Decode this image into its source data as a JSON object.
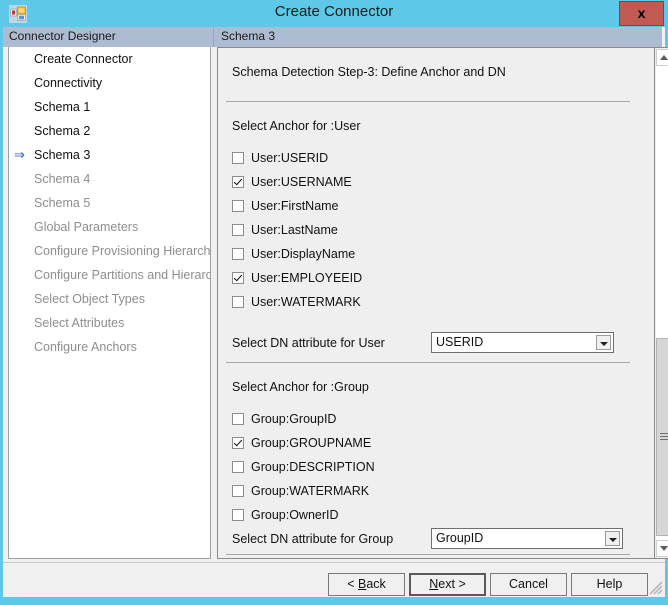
{
  "window": {
    "title": "Create Connector",
    "icon": "connector-app-icon",
    "close_label": "x"
  },
  "sidebar": {
    "header": "Connector Designer",
    "items": [
      {
        "label": "Create Connector",
        "state": "done",
        "current": false
      },
      {
        "label": "Connectivity",
        "state": "done",
        "current": false
      },
      {
        "label": "Schema 1",
        "state": "done",
        "current": false
      },
      {
        "label": "Schema 2",
        "state": "done",
        "current": false
      },
      {
        "label": "Schema 3",
        "state": "done",
        "current": true
      },
      {
        "label": "Schema 4",
        "state": "disabled",
        "current": false
      },
      {
        "label": "Schema 5",
        "state": "disabled",
        "current": false
      },
      {
        "label": "Global Parameters",
        "state": "disabled",
        "current": false
      },
      {
        "label": "Configure Provisioning Hierarchy",
        "state": "disabled",
        "current": false
      },
      {
        "label": "Configure Partitions and Hierarchies",
        "state": "disabled",
        "current": false
      },
      {
        "label": "Select Object Types",
        "state": "disabled",
        "current": false
      },
      {
        "label": "Select Attributes",
        "state": "disabled",
        "current": false
      },
      {
        "label": "Configure Anchors",
        "state": "disabled",
        "current": false
      }
    ]
  },
  "content": {
    "header": "Schema 3",
    "step_title": "Schema Detection Step-3: Define Anchor and DN",
    "user_section": {
      "label": "Select Anchor for :User",
      "checkboxes": [
        {
          "label": "User:USERID",
          "checked": false
        },
        {
          "label": "User:USERNAME",
          "checked": true
        },
        {
          "label": "User:FirstName",
          "checked": false
        },
        {
          "label": "User:LastName",
          "checked": false
        },
        {
          "label": "User:DisplayName",
          "checked": false
        },
        {
          "label": "User:EMPLOYEEID",
          "checked": true
        },
        {
          "label": "User:WATERMARK",
          "checked": false
        }
      ],
      "dn_label": "Select DN attribute for User",
      "dn_value": "USERID"
    },
    "group_section": {
      "label": "Select Anchor for :Group",
      "checkboxes": [
        {
          "label": "Group:GroupID",
          "checked": false
        },
        {
          "label": "Group:GROUPNAME",
          "checked": true
        },
        {
          "label": "Group:DESCRIPTION",
          "checked": false
        },
        {
          "label": "Group:WATERMARK",
          "checked": false
        },
        {
          "label": "Group:OwnerID",
          "checked": false
        }
      ],
      "dn_label": "Select DN attribute for Group",
      "dn_value": "GroupID"
    }
  },
  "scrollbar": {
    "up_icon": "chevron-up-icon",
    "down_icon": "chevron-down-icon",
    "thumb_position": "lower"
  },
  "footer": {
    "buttons": [
      {
        "name": "back",
        "prefix": "< ",
        "accel": "B",
        "rest": "ack",
        "suffix": "",
        "default": false
      },
      {
        "name": "next",
        "prefix": "",
        "accel": "N",
        "rest": "ext",
        "suffix": " >",
        "default": true
      },
      {
        "name": "cancel",
        "prefix": "",
        "accel": "",
        "rest": "Cancel",
        "suffix": "",
        "default": false
      },
      {
        "name": "help",
        "prefix": "",
        "accel": "",
        "rest": "Help",
        "suffix": "",
        "default": false
      }
    ]
  },
  "colors": {
    "window_frame": "#5ec8e8",
    "header_band": "#adbcd0",
    "panel_bg": "#efefef",
    "close_button": "#c05a52",
    "arrow_marker": "#2a5db0"
  }
}
